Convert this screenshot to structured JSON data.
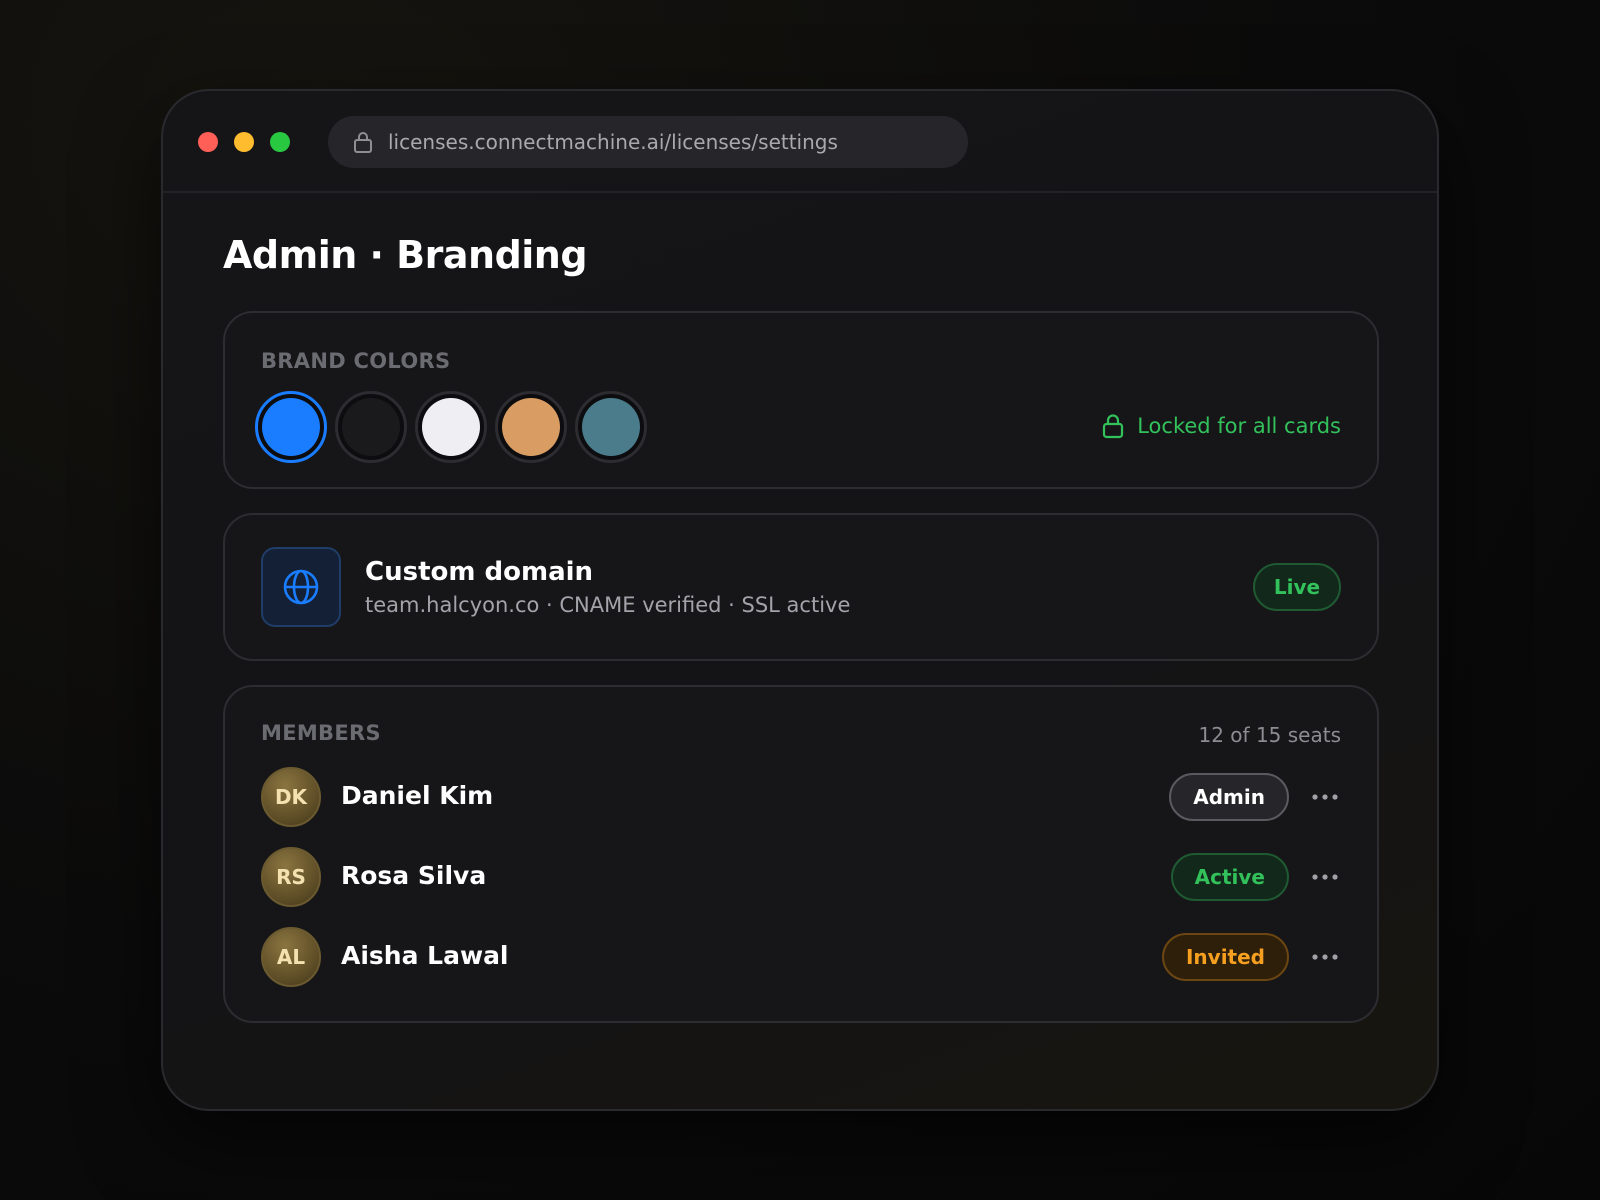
{
  "browser": {
    "url": "licenses.connectmachine.ai/licenses/settings"
  },
  "page": {
    "title": "Admin · Branding"
  },
  "brand_colors": {
    "label": "BRAND COLORS",
    "swatches": [
      {
        "name": "blue",
        "color": "#1a7cff",
        "selected": true
      },
      {
        "name": "black",
        "color": "#1a1a1c",
        "selected": false
      },
      {
        "name": "white",
        "color": "#eeeef3",
        "selected": false
      },
      {
        "name": "tan",
        "color": "#d99c62",
        "selected": false
      },
      {
        "name": "teal",
        "color": "#4a7c8c",
        "selected": false
      }
    ],
    "lock_text": "Locked for all cards",
    "lock_color": "#32c15a"
  },
  "domain": {
    "icon": "globe-icon",
    "title": "Custom domain",
    "subtitle": "team.halcyon.co · CNAME verified · SSL active",
    "status": "Live"
  },
  "members": {
    "label": "MEMBERS",
    "seats": "12 of 15 seats",
    "rows": [
      {
        "initials": "DK",
        "name": "Daniel Kim",
        "role": "Admin",
        "role_type": "admin"
      },
      {
        "initials": "RS",
        "name": "Rosa Silva",
        "role": "Active",
        "role_type": "active"
      },
      {
        "initials": "AL",
        "name": "Aisha Lawal",
        "role": "Invited",
        "role_type": "invited"
      }
    ]
  }
}
